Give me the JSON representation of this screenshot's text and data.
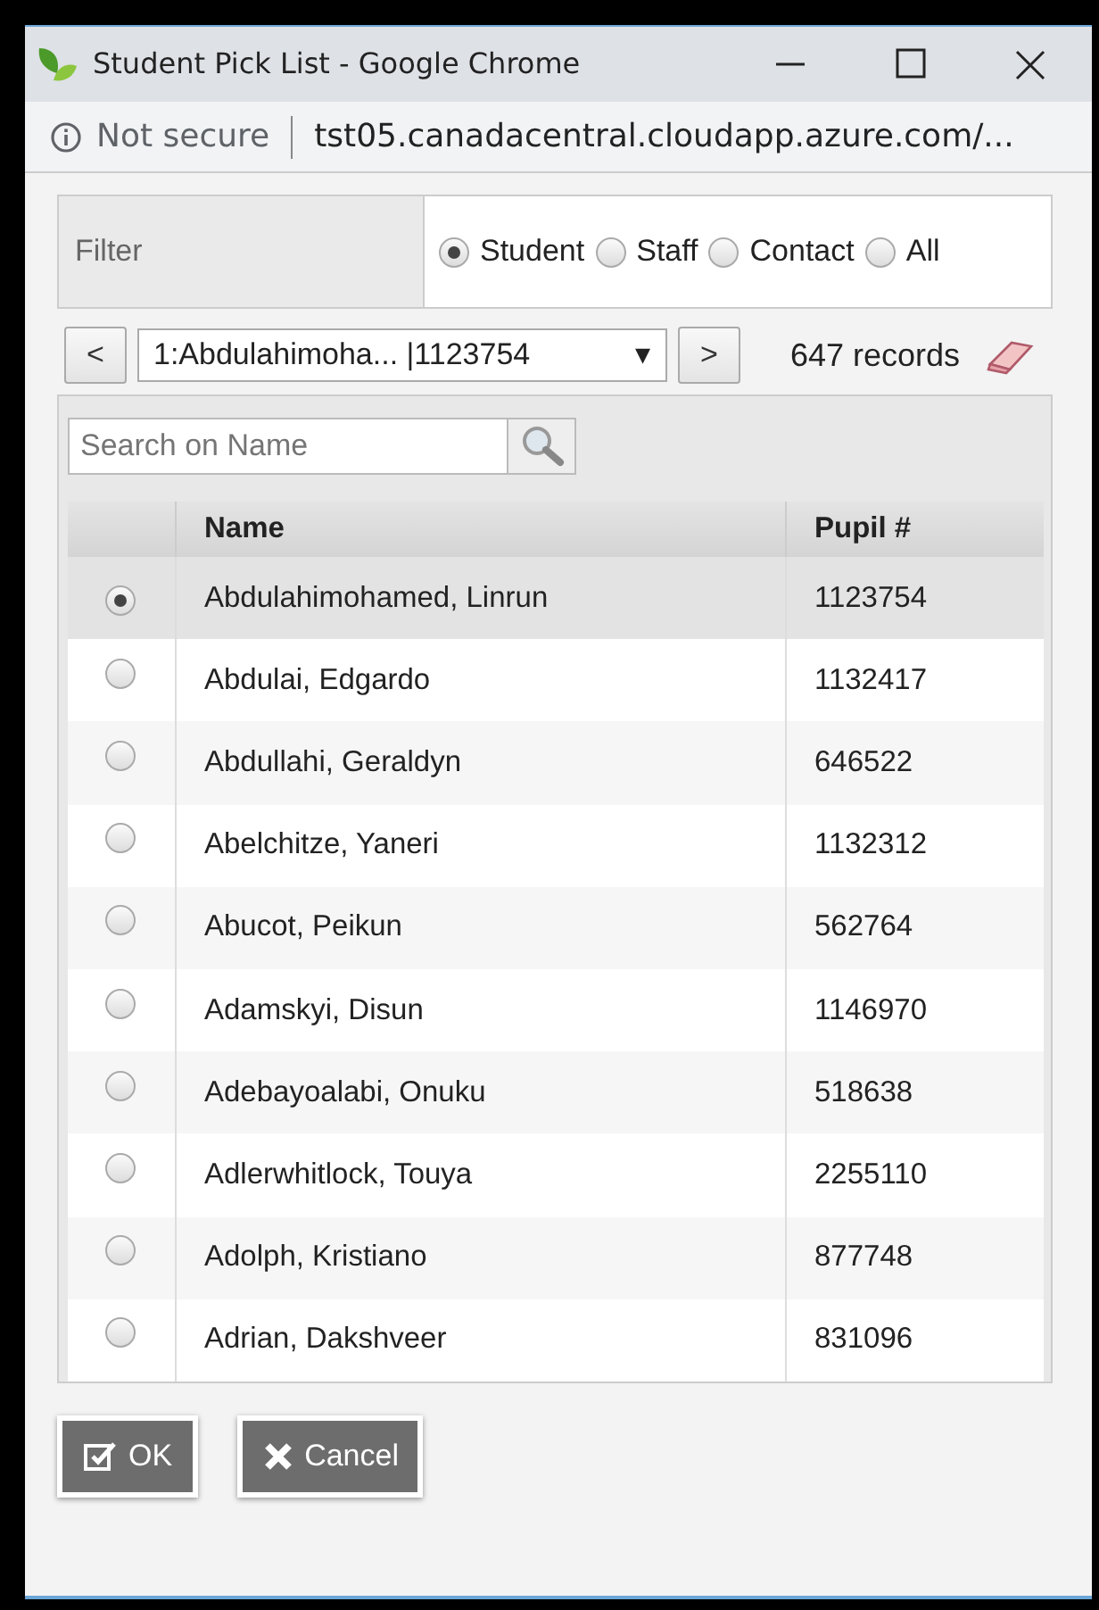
{
  "window": {
    "title": "Student Pick List - Google Chrome"
  },
  "address_bar": {
    "security": "Not secure",
    "url": "tst05.canadacentral.cloudapp.azure.com/..."
  },
  "filter": {
    "label": "Filter",
    "options": [
      {
        "label": "Student",
        "selected": true
      },
      {
        "label": "Staff",
        "selected": false
      },
      {
        "label": "Contact",
        "selected": false
      },
      {
        "label": "All",
        "selected": false
      }
    ]
  },
  "navigator": {
    "prev": "<",
    "current": "1:Abdulahimoha... |1123754",
    "dropdown_arrow": "▾",
    "next": ">",
    "count": "647 records"
  },
  "search": {
    "placeholder": "Search on Name"
  },
  "table": {
    "columns": [
      "Name",
      "Pupil #"
    ],
    "rows": [
      {
        "name": "Abdulahimohamed, Linrun",
        "pupil": "1123754",
        "selected": true
      },
      {
        "name": "Abdulai, Edgardo",
        "pupil": "1132417",
        "selected": false
      },
      {
        "name": "Abdullahi, Geraldyn",
        "pupil": "646522",
        "selected": false
      },
      {
        "name": "Abelchitze, Yaneri",
        "pupil": "1132312",
        "selected": false
      },
      {
        "name": "Abucot, Peikun",
        "pupil": "562764",
        "selected": false
      },
      {
        "name": "Adamskyi, Disun",
        "pupil": "1146970",
        "selected": false
      },
      {
        "name": "Adebayoalabi, Onuku",
        "pupil": "518638",
        "selected": false
      },
      {
        "name": "Adlerwhitlock, Touya",
        "pupil": "2255110",
        "selected": false
      },
      {
        "name": "Adolph, Kristiano",
        "pupil": "877748",
        "selected": false
      },
      {
        "name": "Adrian, Dakshveer",
        "pupil": "831096",
        "selected": false
      }
    ]
  },
  "buttons": [
    {
      "kind": "ok",
      "label": "OK"
    },
    {
      "kind": "cancel",
      "label": "Cancel"
    }
  ]
}
